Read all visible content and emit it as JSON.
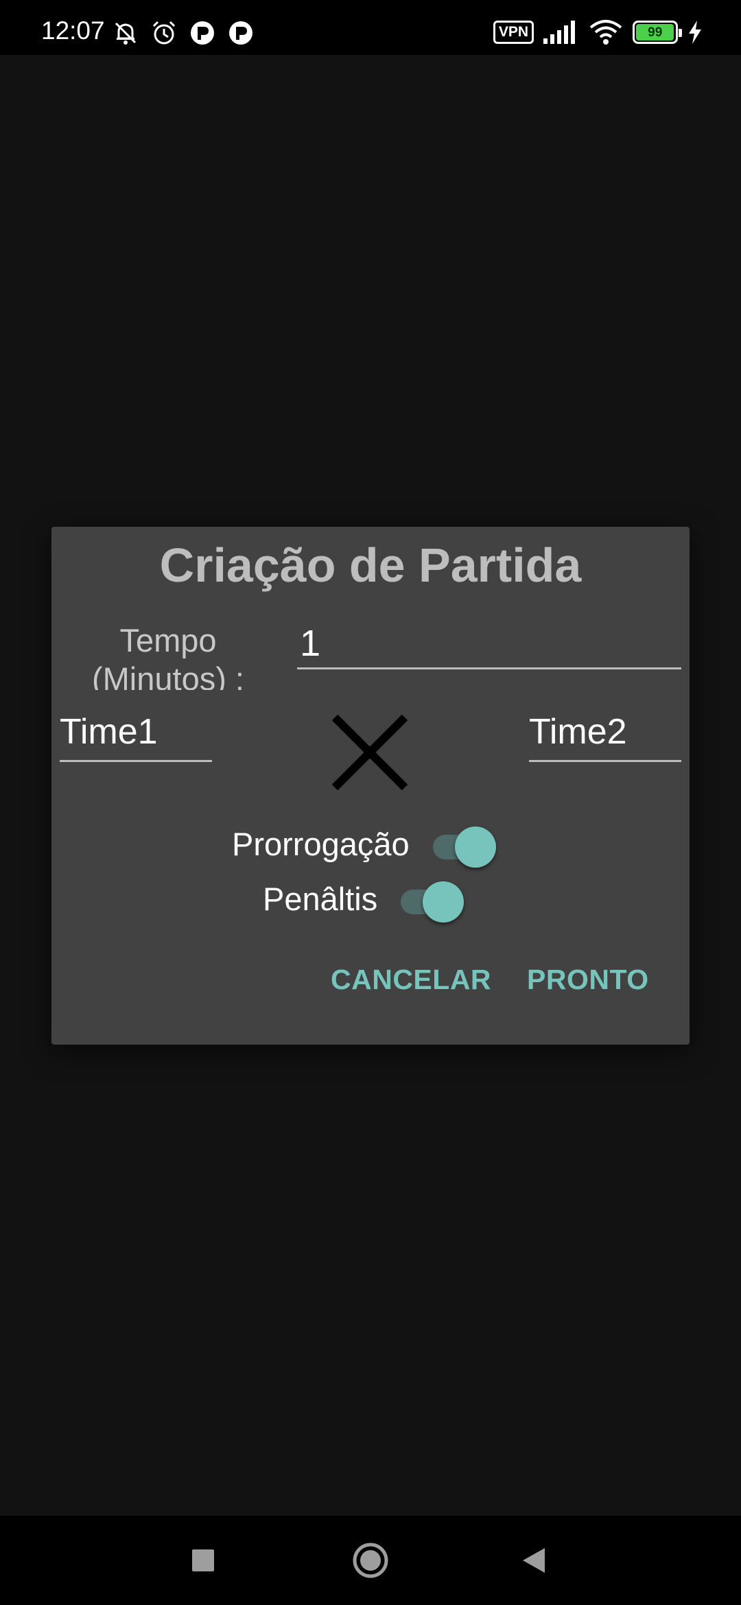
{
  "status_bar": {
    "time": "12:07",
    "left_icons": [
      "bell-off-icon",
      "alarm-icon",
      "app-notification-icon",
      "app-notification-icon"
    ],
    "vpn_label": "VPN",
    "battery_level": "99",
    "right_icons": [
      "vpn-icon",
      "signal-icon",
      "wifi-icon",
      "battery-icon",
      "charging-icon"
    ]
  },
  "dialog": {
    "title": "Criação de Partida",
    "tempo_label": "Tempo (Minutos) :",
    "tempo_value": "1",
    "team1_value": "Time1",
    "team2_value": "Time2",
    "vs_icon": "close-x-icon",
    "prorrogacao_label": "Prorrogação",
    "prorrogacao_enabled": true,
    "penaltis_label": "Penâltis",
    "penaltis_enabled": true,
    "cancel_label": "CANCELAR",
    "ok_label": "PRONTO"
  },
  "navigation": {
    "icons": [
      "recents-square-icon",
      "home-circle-icon",
      "back-triangle-icon"
    ]
  },
  "colors": {
    "accent": "#77c4bd",
    "dialog_bg": "#424242",
    "screen_bg": "#121212",
    "bars_bg": "#000000"
  }
}
